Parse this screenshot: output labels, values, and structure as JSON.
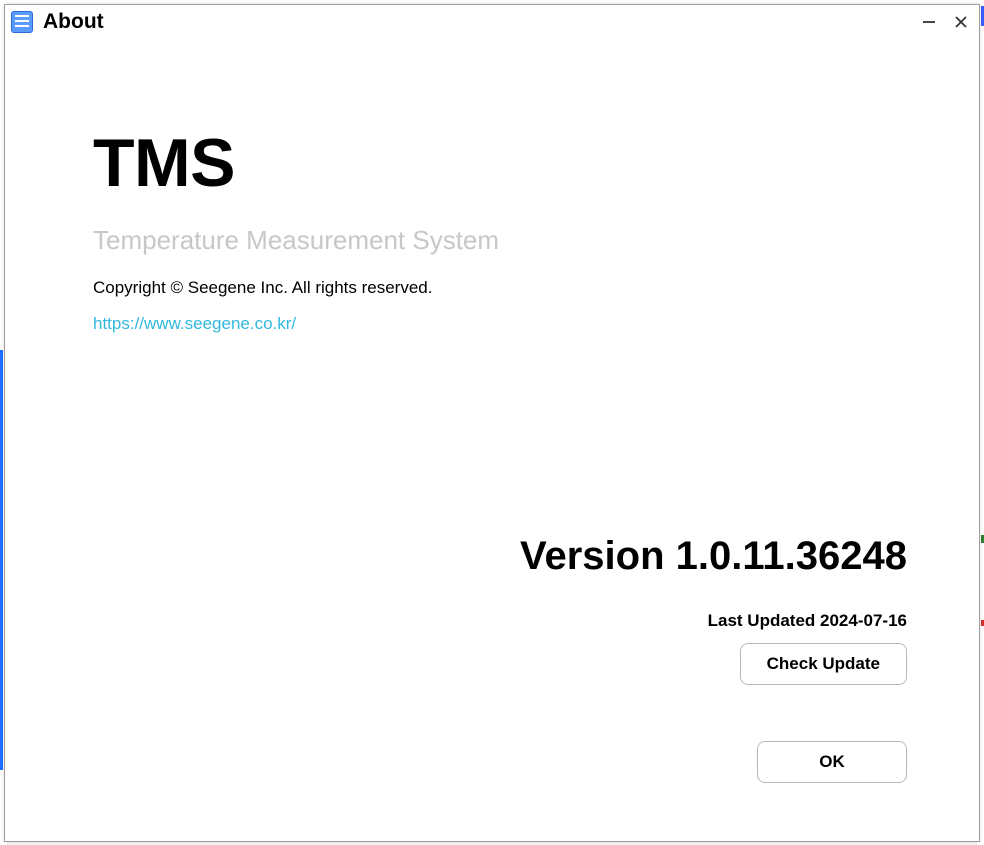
{
  "window": {
    "title": "About"
  },
  "about": {
    "product_name": "TMS",
    "product_subtitle": "Temperature Measurement System",
    "copyright": "Copyright © Seegene Inc. All rights reserved.",
    "url": "https://www.seegene.co.kr/",
    "version_label": "Version 1.0.11.36248",
    "last_updated": "Last Updated 2024-07-16",
    "check_update_label": "Check Update",
    "ok_label": "OK"
  }
}
